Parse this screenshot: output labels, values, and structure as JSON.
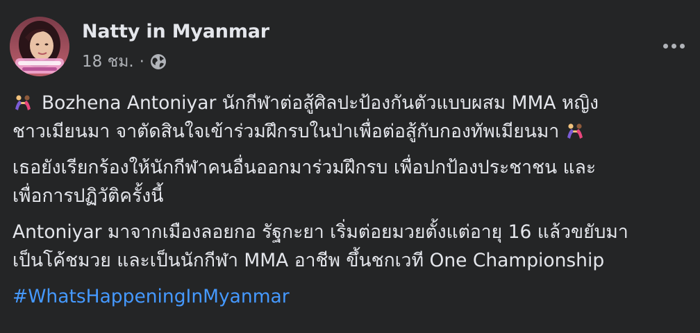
{
  "post": {
    "author": {
      "name": "Natty in Myanmar",
      "avatar": "profile-photo"
    },
    "meta": {
      "time": "18 ชม.",
      "separator": "·",
      "audience_icon": "globe-icon"
    },
    "menu_icon": "more-options-icon",
    "paragraphs": [
      {
        "lines": [
          "Bozhena Antoniyar นักกีฬาต่อสู้ศิลปะป้องกันตัวแบบผสม MMA หญิง",
          "ชาวเมียนมา จาตัดสินใจเข้าร่วมฝึกรบในป่าเพื่อต่อสู้กับกองทัพเมียนมา"
        ],
        "emoji": "wrestlers-emoji"
      },
      {
        "lines": [
          "เธอยังเรียกร้องให้นักกีฬาคนอื่นออกมาร่วมฝึกรบ เพื่อปกป้องประชาชน และ",
          "เพื่อการปฏิวัติครั้งนี้"
        ]
      },
      {
        "lines": [
          "Antoniyar มาจากเมืองลอยกอ รัฐกะยา เริ่มต่อยมวยตั้งแต่อายุ 16 แล้วขยับมา",
          "เป็นโค้ชมวย และเป็นนักกีฬา MMA อาชีพ ขึ้นชกเวที One Championship"
        ]
      }
    ],
    "hashtag": "#WhatsHappeningInMyanmar",
    "colors": {
      "background": "#242526",
      "text": "#e4e6eb",
      "secondary_text": "#b0b3b8",
      "link": "#4599ff"
    }
  }
}
